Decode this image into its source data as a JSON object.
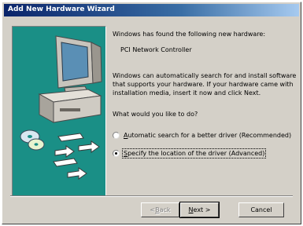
{
  "window": {
    "title": "Add New Hardware Wizard"
  },
  "illustration": {
    "icons": [
      "computer-icon",
      "cd-icon",
      "card-icon",
      "arrow-icon",
      "arrow-icon",
      "arrow-icon"
    ]
  },
  "content": {
    "found_message": "Windows has found the following new hardware:",
    "device_name": "PCI Network Controller",
    "install_message": "Windows can automatically search for and install software that supports your hardware. If your hardware came with installation media, insert it now and click Next.",
    "question": "What would you like to do?"
  },
  "options": [
    {
      "mnemonic": "A",
      "rest": "utomatic search for a better driver (Recommended)",
      "selected": false
    },
    {
      "mnemonic": "S",
      "rest": "pecify the location of the driver (Advanced)",
      "selected": true
    }
  ],
  "buttons": {
    "back": {
      "mnemonic": "B",
      "prefix": "< ",
      "rest": "ack",
      "enabled": false
    },
    "next": {
      "mnemonic": "N",
      "rest": "ext >",
      "enabled": true
    },
    "cancel": {
      "label": "Cancel",
      "enabled": true
    }
  },
  "colors": {
    "title_bar": "#0a246a",
    "panel": "#d4d0c8",
    "illustration_bg": "#1a8f86"
  }
}
